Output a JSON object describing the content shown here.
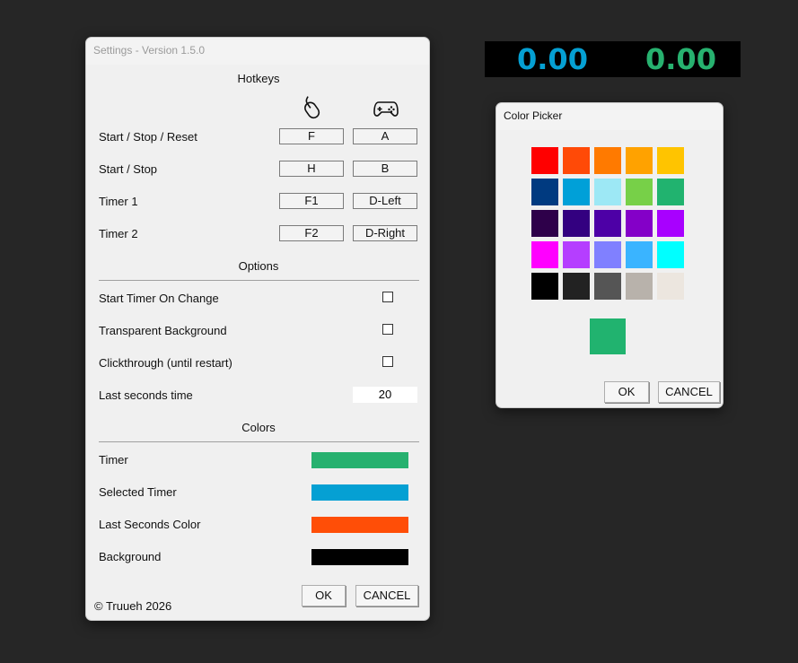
{
  "settings": {
    "title": "Settings - Version 1.5.0",
    "hotkeys_header": "Hotkeys",
    "hotkeys": [
      {
        "label": "Start / Stop / Reset",
        "mouse": "F",
        "pad": "A"
      },
      {
        "label": "Start / Stop",
        "mouse": "H",
        "pad": "B"
      },
      {
        "label": "Timer 1",
        "mouse": "F1",
        "pad": "D-Left"
      },
      {
        "label": "Timer 2",
        "mouse": "F2",
        "pad": "D-Right"
      }
    ],
    "options_header": "Options",
    "options": {
      "start_on_change": "Start Timer On Change",
      "transparent_bg": "Transparent Background",
      "clickthrough": "Clickthrough (until restart)",
      "last_seconds_label": "Last seconds time",
      "last_seconds_value": "20"
    },
    "colors_header": "Colors",
    "colors": [
      {
        "label": "Timer",
        "color": "#27b16f"
      },
      {
        "label": "Selected Timer",
        "color": "#05a0d3"
      },
      {
        "label": "Last Seconds Color",
        "color": "#ff4e07"
      },
      {
        "label": "Background",
        "color": "#000000"
      }
    ],
    "ok": "OK",
    "cancel": "CANCEL",
    "copyright": "© Truueh 2026"
  },
  "timers": {
    "timer1": "0.00",
    "timer1_color": "#05a0d3",
    "timer2": "0.00",
    "timer2_color": "#27b16f"
  },
  "picker": {
    "title": "Color Picker",
    "palette": [
      "#ff0000",
      "#ff4a07",
      "#ff7a00",
      "#ffa200",
      "#ffc400",
      "#003a80",
      "#00a0d8",
      "#9de8f5",
      "#77d048",
      "#21b36f",
      "#2e004a",
      "#330080",
      "#4d00a6",
      "#8400c8",
      "#a800ff",
      "#ff00ff",
      "#b53eff",
      "#8080ff",
      "#3ab4ff",
      "#00ffff",
      "#000000",
      "#222222",
      "#555555",
      "#b8b2ab",
      "#ece6df"
    ],
    "selected": "#21b36f",
    "ok": "OK",
    "cancel": "CANCEL"
  }
}
